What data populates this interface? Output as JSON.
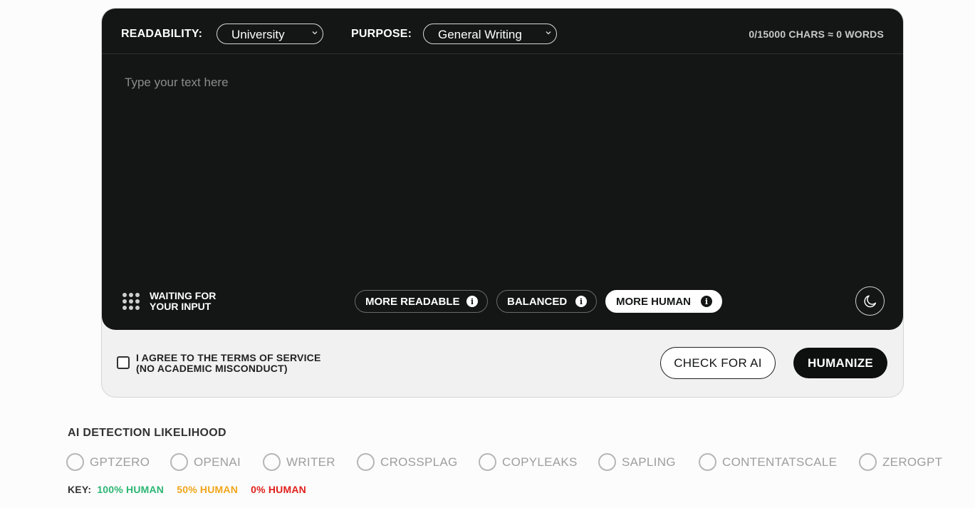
{
  "toolbar": {
    "readability_label": "READABILITY:",
    "readability_value": "University",
    "purpose_label": "PURPOSE:",
    "purpose_value": "General Writing",
    "counter": "0/15000 CHARS ≈ 0 WORDS"
  },
  "editor": {
    "placeholder": "Type your text here"
  },
  "status": {
    "line1": "WAITING FOR",
    "line2": "YOUR INPUT"
  },
  "modes": [
    {
      "label": "MORE READABLE",
      "active": false
    },
    {
      "label": "BALANCED",
      "active": false
    },
    {
      "label": "MORE HUMAN",
      "active": true
    }
  ],
  "agree": {
    "line1": "I AGREE TO THE TERMS OF SERVICE",
    "line2": "(NO ACADEMIC MISCONDUCT)"
  },
  "buttons": {
    "check": "CHECK FOR AI",
    "humanize": "HUMANIZE"
  },
  "detection": {
    "title": "AI DETECTION LIKELIHOOD",
    "detectors": [
      "GPTZERO",
      "OPENAI",
      "WRITER",
      "CROSSPLAG",
      "COPYLEAKS",
      "SAPLING",
      "CONTENTATSCALE",
      "ZEROGPT"
    ]
  },
  "key": {
    "label": "KEY:",
    "items": [
      {
        "text": "100% HUMAN",
        "color": "#2bb673"
      },
      {
        "text": "50% HUMAN",
        "color": "#f2a51a"
      },
      {
        "text": "0% HUMAN",
        "color": "#e0201b"
      }
    ]
  },
  "colors": {
    "editor_bg": "#141515",
    "card_bg": "#f1f1f1"
  }
}
